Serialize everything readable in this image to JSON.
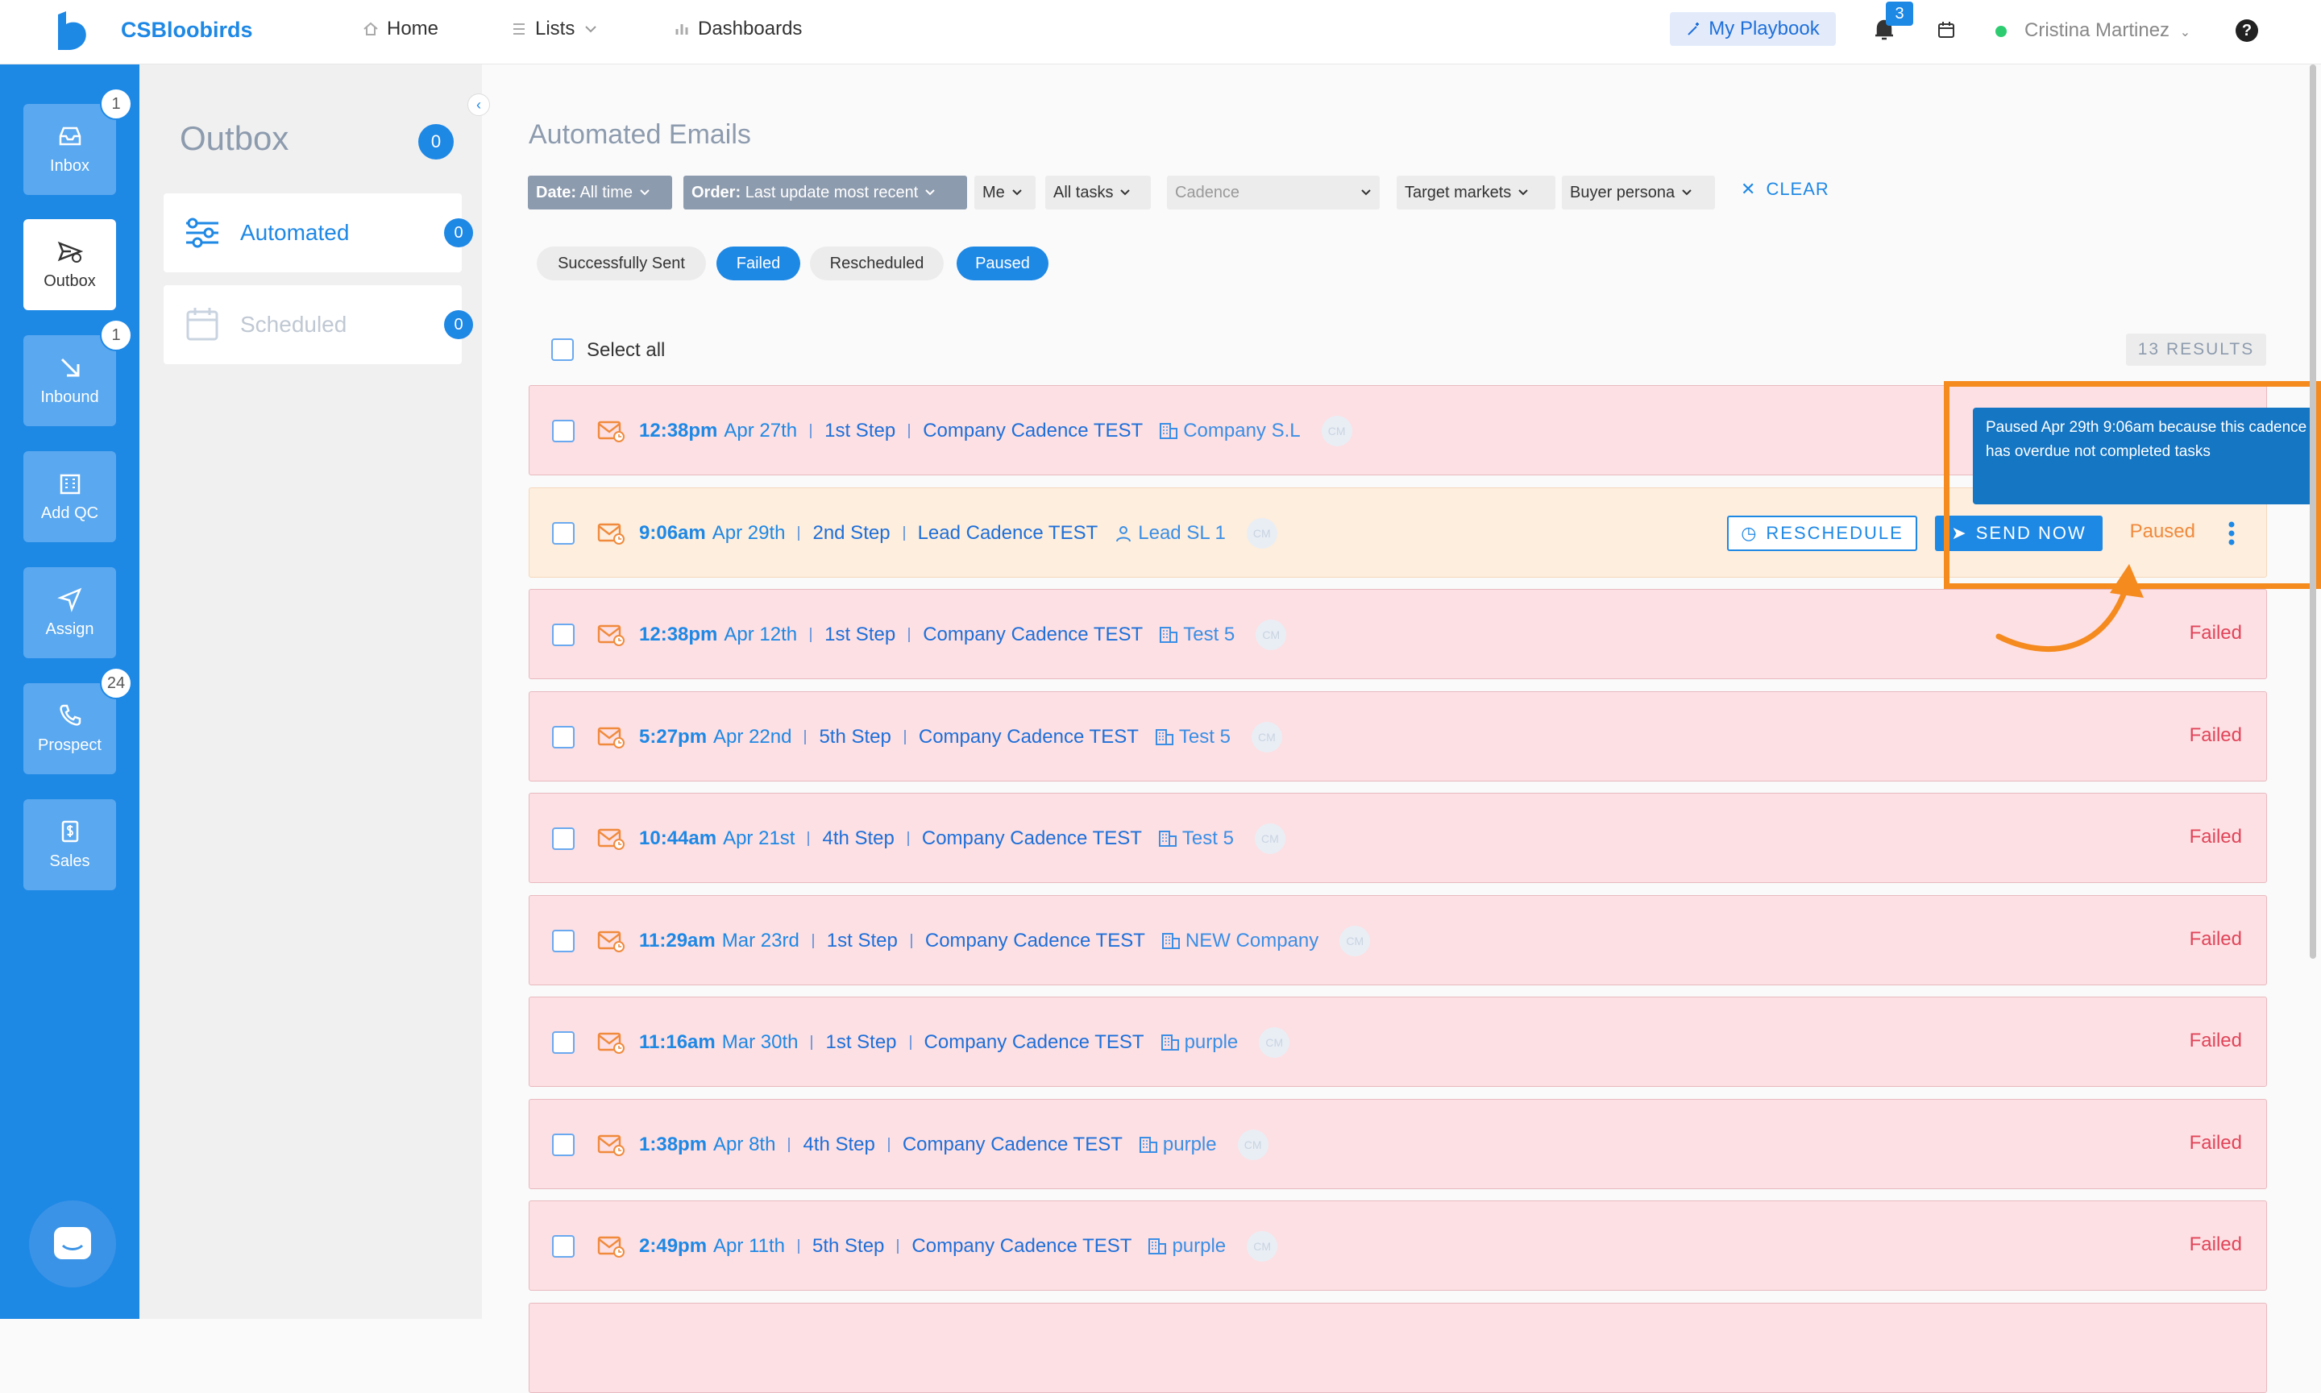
{
  "app": {
    "brand": "CSBloobirds"
  },
  "topnav": {
    "home": "Home",
    "lists": "Lists",
    "dashboards": "Dashboards",
    "playbook": "My Playbook",
    "notifications": "3",
    "user": "Cristina Martinez",
    "help": "?"
  },
  "rail": [
    {
      "label": "Inbox",
      "badge": "1"
    },
    {
      "label": "Outbox",
      "badge": ""
    },
    {
      "label": "Inbound",
      "badge": "1"
    },
    {
      "label": "Add QC",
      "badge": ""
    },
    {
      "label": "Assign",
      "badge": ""
    },
    {
      "label": "Prospect",
      "badge": "24"
    },
    {
      "label": "Sales",
      "badge": ""
    }
  ],
  "subnav": {
    "title": "Outbox",
    "count": "0",
    "items": [
      {
        "label": "Automated",
        "count": "0"
      },
      {
        "label": "Scheduled",
        "count": "0"
      }
    ]
  },
  "main": {
    "title": "Automated Emails",
    "filters": {
      "date_key": "Date:",
      "date_val": "All time",
      "order_key": "Order:",
      "order_val": "Last update most recent",
      "owner": "Me",
      "tasks": "All tasks",
      "cadence_placeholder": "Cadence",
      "target_markets": "Target markets",
      "buyer_persona": "Buyer persona",
      "clear": "CLEAR"
    },
    "chips": [
      "Successfully Sent",
      "Failed",
      "Rescheduled",
      "Paused"
    ],
    "select_all": "Select all",
    "results": "13 RESULTS",
    "rows": [
      {
        "time": "12:38pm",
        "date": "Apr 27th",
        "step": "1st Step",
        "cadence": "Company Cadence TEST",
        "entity": "Company S.L",
        "entity_type": "company",
        "status": ""
      },
      {
        "time": "9:06am",
        "date": "Apr 29th",
        "step": "2nd Step",
        "cadence": "Lead Cadence TEST",
        "entity": "Lead SL 1",
        "entity_type": "lead",
        "status": "Paused"
      },
      {
        "time": "12:38pm",
        "date": "Apr 12th",
        "step": "1st Step",
        "cadence": "Company Cadence TEST",
        "entity": "Test 5",
        "entity_type": "company",
        "status": "Failed"
      },
      {
        "time": "5:27pm",
        "date": "Apr 22nd",
        "step": "5th Step",
        "cadence": "Company Cadence TEST",
        "entity": "Test 5",
        "entity_type": "company",
        "status": "Failed"
      },
      {
        "time": "10:44am",
        "date": "Apr 21st",
        "step": "4th Step",
        "cadence": "Company Cadence TEST",
        "entity": "Test 5",
        "entity_type": "company",
        "status": "Failed"
      },
      {
        "time": "11:29am",
        "date": "Mar 23rd",
        "step": "1st Step",
        "cadence": "Company Cadence TEST",
        "entity": "NEW Company",
        "entity_type": "company",
        "status": "Failed"
      },
      {
        "time": "11:16am",
        "date": "Mar 30th",
        "step": "1st Step",
        "cadence": "Company Cadence TEST",
        "entity": "purple",
        "entity_type": "company",
        "status": "Failed"
      },
      {
        "time": "1:38pm",
        "date": "Apr 8th",
        "step": "4th Step",
        "cadence": "Company Cadence TEST",
        "entity": "purple",
        "entity_type": "company",
        "status": "Failed"
      },
      {
        "time": "2:49pm",
        "date": "Apr 11th",
        "step": "5th Step",
        "cadence": "Company Cadence TEST",
        "entity": "purple",
        "entity_type": "company",
        "status": "Failed"
      }
    ],
    "avatar_initials": "CM",
    "reschedule": "RESCHEDULE",
    "send_now": "SEND NOW",
    "tooltip": "Paused Apr 29th 9:06am because this cadence has overdue not completed tasks"
  },
  "colors": {
    "primary": "#1e88e5",
    "failed_bg": "#fde0e3",
    "paused_bg": "#fdeedd",
    "failed_text": "#e0455a",
    "paused_text": "#f08a3c",
    "highlight": "#f58a1f"
  }
}
